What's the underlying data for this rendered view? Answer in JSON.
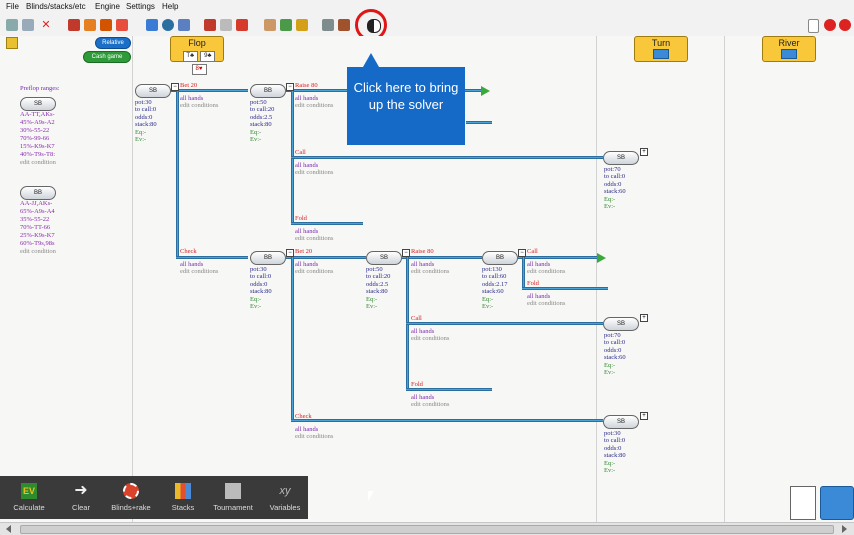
{
  "menu": [
    "File",
    "Blinds/stacks/etc",
    "Engine",
    "Settings",
    "Help"
  ],
  "icons": [
    "undo-icon",
    "redo-icon",
    "delete-icon",
    "tree-icon",
    "solve-icon",
    "stack-icon",
    "export-icon",
    "chart-icon",
    "info-icon",
    "tool-icon",
    "arrow-left-icon",
    "arrow-right-icon",
    "arrow-right2-icon",
    "range-icon",
    "grid-icon",
    "import-icon",
    "copy-icon",
    "paste-icon",
    "yin-yang-icon"
  ],
  "right_icons": [
    "page-icon",
    "stop-icon",
    "close-icon"
  ],
  "mode": {
    "relative": "Relative",
    "cash": "Cash game"
  },
  "streets": {
    "flop": "Flop",
    "flop_cards": [
      "T♣",
      "9♣",
      "8♥"
    ],
    "turn": "Turn",
    "river": "River"
  },
  "preflop": {
    "title": "Preflop ranges:",
    "sb_label": "SB",
    "sb_ranges": [
      "AA-TT,AKs-",
      "45%-A9s-A2",
      "30%-55-22",
      "70%-99-66",
      "15%-K9s-K7",
      "40%-T9s-T8:"
    ],
    "sb_edit": "edit condition",
    "bb_label": "BB",
    "bb_ranges": [
      "AA-JJ,AKs-",
      "65%-A9s-A4",
      "35%-55-22",
      "70%-TT-66",
      "25%-K9s-K7",
      "60%-T9s,98s"
    ],
    "bb_edit": "edit condition"
  },
  "nodes": {
    "n1": {
      "player": "SB",
      "lines": [
        "pot:30",
        "to call:0",
        "odds:0",
        "stack:80"
      ],
      "eq": "Eq:-",
      "ev": "Ev:-"
    },
    "n2": {
      "player": "BB",
      "lines": [
        "pot:50",
        "to call:20",
        "odds:2.5",
        "stack:80"
      ],
      "eq": "Eq:-",
      "ev": "Ev:-"
    },
    "n3": {
      "player": "SB",
      "lines": [
        "pot:70",
        "to call:0",
        "odds:0",
        "stack:60"
      ],
      "eq": "Eq:-",
      "ev": "Ev:-"
    },
    "n4": {
      "player": "BB",
      "lines": [
        "pot:30",
        "to call:0",
        "odds:0",
        "stack:80"
      ],
      "eq": "Eq:-",
      "ev": "Ev:-"
    },
    "n5": {
      "player": "SB",
      "lines": [
        "pot:50",
        "to call:20",
        "odds:2.5",
        "stack:80"
      ],
      "eq": "Eq:-",
      "ev": "Ev:-"
    },
    "n6": {
      "player": "BB",
      "lines": [
        "pot:130",
        "to call:60",
        "odds:2.17",
        "stack:60"
      ],
      "eq": "Eq:-",
      "ev": "Ev:-"
    },
    "n7": {
      "player": "SB",
      "lines": [
        "pot:70",
        "to call:0",
        "odds:0",
        "stack:60"
      ],
      "eq": "Eq:-",
      "ev": "Ev:-"
    },
    "n8": {
      "player": "SB",
      "lines": [
        "pot:30",
        "to call:0",
        "odds:0",
        "stack:80"
      ],
      "eq": "Eq:-",
      "ev": "Ev:-"
    }
  },
  "actions": {
    "bet20": {
      "title": "Bet 20",
      "hands": "all hands",
      "edit": "edit conditions"
    },
    "raise80": {
      "title": "Raise 80",
      "hands": "all hands",
      "edit": "edit conditions"
    },
    "call1": {
      "title": "Call",
      "hands": "all hands",
      "edit": "edit conditions"
    },
    "fold1": {
      "title": "Fold",
      "hands": "all hands",
      "edit": "edit conditions"
    },
    "check1": {
      "title": "Check",
      "hands": "all hands",
      "edit": "edit conditions"
    },
    "bet20b": {
      "title": "Bet 20",
      "hands": "all hands",
      "edit": "edit conditions"
    },
    "raise80b": {
      "title": "Raise 80",
      "hands": "all hands",
      "edit": "edit conditions"
    },
    "call2": {
      "title": "Call",
      "hands": "all hands",
      "edit": "edit conditions"
    },
    "fold2": {
      "title": "Fold",
      "hands": "all hands",
      "edit": "edit conditions"
    },
    "call3": {
      "title": "Call",
      "hands": "all hands",
      "edit": "edit conditions"
    },
    "fold3": {
      "title": "Fold",
      "hands": "all hands",
      "edit": "edit conditions"
    },
    "check2": {
      "title": "Check",
      "hands": "all hands",
      "edit": "edit conditions"
    }
  },
  "tooltip": "Click here to bring up the solver",
  "bottom": [
    {
      "label": "Calculate",
      "icon": "ev-icon"
    },
    {
      "label": "Clear",
      "icon": "arrow-icon"
    },
    {
      "label": "Blinds+rake",
      "icon": "chip-icon"
    },
    {
      "label": "Stacks",
      "icon": "stacks-icon"
    },
    {
      "label": "Tournament",
      "icon": "tournament-icon"
    },
    {
      "label": "Variables",
      "icon": "xy-icon"
    }
  ],
  "colors": {
    "accent": "#1569c7",
    "line": "#4aa3d6",
    "highlight": "#e02020",
    "street": "#f8c83a"
  }
}
